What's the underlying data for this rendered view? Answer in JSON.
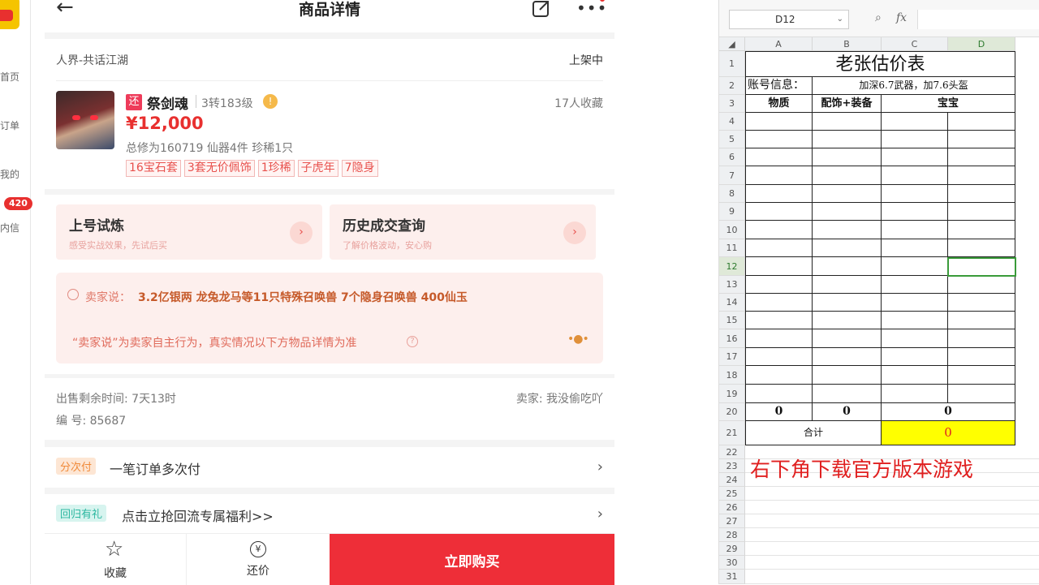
{
  "leftnav": {
    "items": [
      {
        "label": "首页"
      },
      {
        "label": "订单"
      },
      {
        "label": "我的"
      },
      {
        "label": "内信"
      }
    ],
    "badge": "420"
  },
  "header": {
    "title": "商品详情"
  },
  "product": {
    "server": "人界-共话江湖",
    "status": "上架中",
    "tag_icon": "还",
    "name": "祭剑魂",
    "level": "3转183级",
    "favorites": "17人收藏",
    "price": "¥12,000",
    "summary": "总修为160719  仙器4件  珍稀1只",
    "tags": [
      "16宝石套",
      "3套无价佩饰",
      "1珍稀",
      "子虎年",
      "7隐身"
    ]
  },
  "promos": [
    {
      "title": "上号试炼",
      "subtitle": "感受实战效果，先试后买"
    },
    {
      "title": "历史成交查询",
      "subtitle": "了解价格波动，安心购"
    }
  ],
  "seller_note": {
    "label": "卖家说：",
    "text": "3.2亿银两 龙兔龙马等11只特殊召唤兽 7个隐身召唤兽 400仙玉",
    "disclaimer": "“卖家说”为卖家自主行为，真实情况以下方物品详情为准"
  },
  "meta": {
    "remaining": "出售剩余时间: 7天13时",
    "seller": "卖家: 我没偷吃吖",
    "id": "编 号: 85687"
  },
  "rows": [
    {
      "pill": "分次付",
      "text": "一笔订单多次付"
    },
    {
      "pill": "回归有礼",
      "text": "点击立抢回流专属福利>>"
    }
  ],
  "bottombar": {
    "fav": "收藏",
    "bargain": "还价",
    "bargain_icon": "¥",
    "buy": "立即购买"
  },
  "spreadsheet": {
    "namebox": "D12",
    "fx": "fx",
    "columns": [
      "A",
      "B",
      "C",
      "D"
    ],
    "rows": [
      "1",
      "2",
      "3",
      "4",
      "5",
      "6",
      "7",
      "8",
      "9",
      "10",
      "11",
      "12",
      "13",
      "14",
      "15",
      "16",
      "17",
      "18",
      "19",
      "20",
      "21",
      "22",
      "23",
      "24",
      "25",
      "26",
      "27",
      "28",
      "29",
      "30",
      "31"
    ],
    "title": "老张估价表",
    "account_label": "账号信息：",
    "account_value": "加深6.7武器，加7.6头盔",
    "headers": [
      "物质",
      "配饰+装备",
      "宝宝"
    ],
    "row20": [
      "0",
      "0",
      "0"
    ],
    "total_label": "合计",
    "total_value": "0",
    "note": "右下角下载官方版本游戏",
    "colors": {
      "highlight": "#ffff00",
      "note": "#e02020",
      "selection": "#3a9b3a"
    }
  }
}
